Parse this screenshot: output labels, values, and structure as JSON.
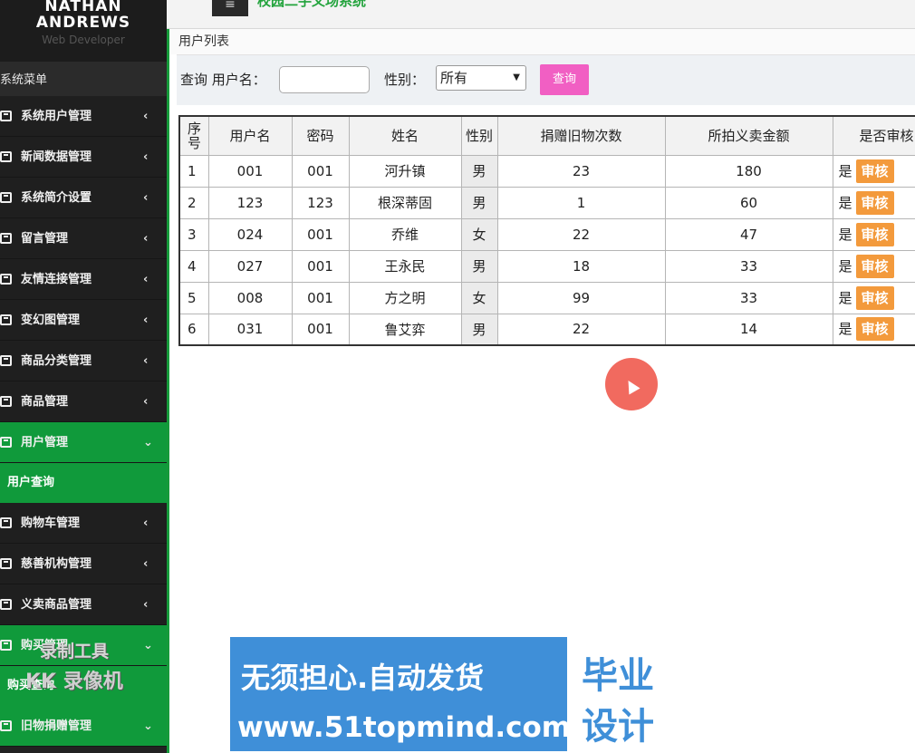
{
  "header": {
    "menu_icon": "hamburger-icon",
    "title": "校园二手义场系统"
  },
  "brand": {
    "name_line1": "NATHAN",
    "name_line2": "ANDREWS",
    "subtitle": "Web Developer"
  },
  "sidebar": {
    "header": "系统菜单",
    "items": [
      {
        "label": "系统用户管理",
        "caret": "‹"
      },
      {
        "label": "新闻数据管理",
        "caret": "‹"
      },
      {
        "label": "系统简介设置",
        "caret": "‹"
      },
      {
        "label": "留言管理",
        "caret": "‹"
      },
      {
        "label": "友情连接管理",
        "caret": "‹"
      },
      {
        "label": "变幻图管理",
        "caret": "‹"
      },
      {
        "label": "商品分类管理",
        "caret": "‹"
      },
      {
        "label": "商品管理",
        "caret": "‹"
      },
      {
        "label": "用户管理",
        "caret": "⌄"
      },
      {
        "label": "用户查询"
      },
      {
        "label": "购物车管理",
        "caret": "‹"
      },
      {
        "label": "慈善机构管理",
        "caret": "‹"
      },
      {
        "label": "义卖商品管理",
        "caret": "‹"
      },
      {
        "label": "购买管理",
        "caret": "⌄"
      },
      {
        "label": "购买查询"
      },
      {
        "label": "旧物捐赠管理",
        "caret": "⌄"
      }
    ]
  },
  "breadcrumb": "用户列表",
  "filter": {
    "query_label": "查询 用户名：",
    "username_value": "",
    "gender_label": "性别：",
    "gender_selected": "所有",
    "search_label": "查询"
  },
  "table": {
    "headers": [
      "序号",
      "用户名",
      "密码",
      "姓名",
      "性别",
      "捐赠旧物次数",
      "所拍义卖金额",
      "是否审核"
    ],
    "rows": [
      {
        "no": "1",
        "username": "001",
        "password": "001",
        "name": "河升镇",
        "gender": "男",
        "donations": "23",
        "amount": "180",
        "approved": "是",
        "action": "审核"
      },
      {
        "no": "2",
        "username": "123",
        "password": "123",
        "name": "根深蒂固",
        "gender": "男",
        "donations": "1",
        "amount": "60",
        "approved": "是",
        "action": "审核"
      },
      {
        "no": "3",
        "username": "024",
        "password": "001",
        "name": "乔维",
        "gender": "女",
        "donations": "22",
        "amount": "47",
        "approved": "是",
        "action": "审核"
      },
      {
        "no": "4",
        "username": "027",
        "password": "001",
        "name": "王永民",
        "gender": "男",
        "donations": "18",
        "amount": "33",
        "approved": "是",
        "action": "审核"
      },
      {
        "no": "5",
        "username": "008",
        "password": "001",
        "name": "方之明",
        "gender": "女",
        "donations": "99",
        "amount": "33",
        "approved": "是",
        "action": "审核"
      },
      {
        "no": "6",
        "username": "031",
        "password": "001",
        "name": "鲁艾弈",
        "gender": "男",
        "donations": "22",
        "amount": "14",
        "approved": "是",
        "action": "审核"
      }
    ]
  },
  "watermark": {
    "line1": "录制工具",
    "line2": "KK 录像机"
  },
  "banner": {
    "main_text": "无须担心.自动发货",
    "url": "www.51topmind.com",
    "right_line1": "毕业",
    "right_line2": "设计"
  },
  "colors": {
    "sidebar_bg": "#222222",
    "active_green": "#109a3b",
    "search_pink": "#f15fc3",
    "approve_orange": "#f39a3c",
    "banner_blue": "#3f8fd8"
  }
}
